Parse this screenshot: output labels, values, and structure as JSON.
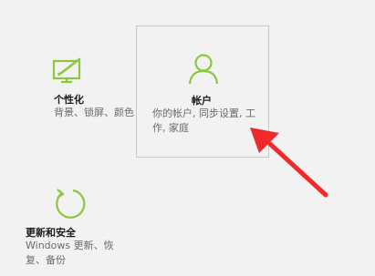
{
  "accent_color": "#8dc63f",
  "arrow_color": "#ee2a2a",
  "tiles": {
    "personalization": {
      "icon": "paint-monitor-icon",
      "title": "个性化",
      "description": "背景、锁屏、颜色"
    },
    "accounts": {
      "icon": "person-icon",
      "title": "帐户",
      "description": "你的帐户, 同步设置, 工作, 家庭"
    },
    "update_security": {
      "icon": "refresh-icon",
      "title": "更新和安全",
      "description": "Windows 更新、恢复、备份"
    }
  }
}
